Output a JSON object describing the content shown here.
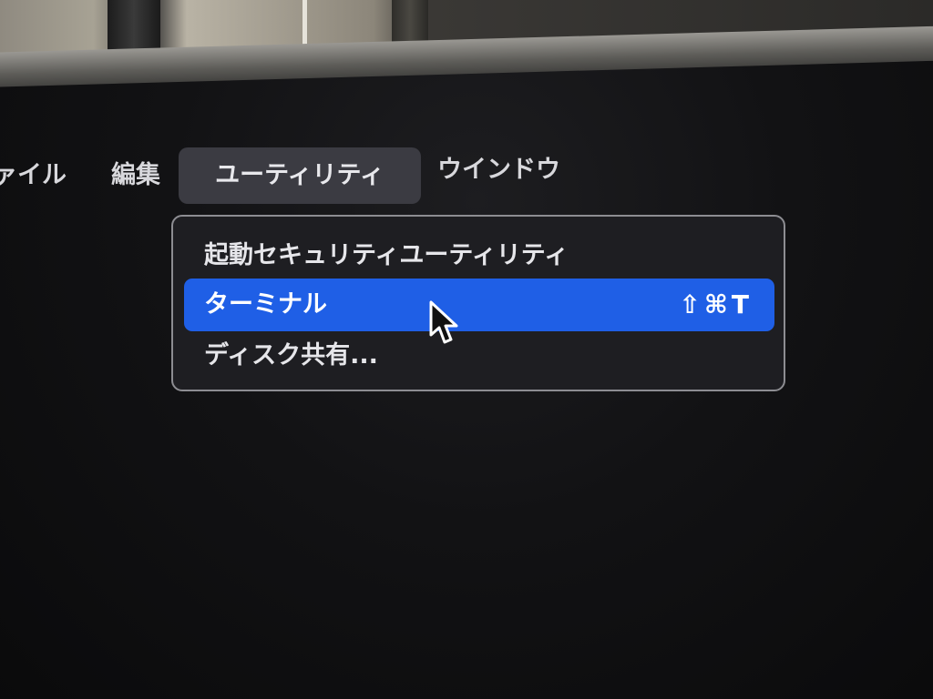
{
  "menubar": {
    "items": [
      {
        "label": "ァイル"
      },
      {
        "label": "編集"
      },
      {
        "label": "ユーティリティ"
      },
      {
        "label": "ウインドウ"
      }
    ]
  },
  "utility_menu": {
    "items": [
      {
        "label": "起動セキュリティユーティリティ",
        "shortcut": ""
      },
      {
        "label": "ターミナル",
        "shortcut": "⇧⌘T",
        "highlighted": true
      },
      {
        "label": "ディスク共有..."
      }
    ]
  },
  "colors": {
    "highlight": "#1f5fe6",
    "menu_background": "#1e1e22",
    "active_menu": "#3b3b42",
    "screen": "#121214"
  },
  "icons": {
    "pointer": "arrow-pointer-icon"
  }
}
